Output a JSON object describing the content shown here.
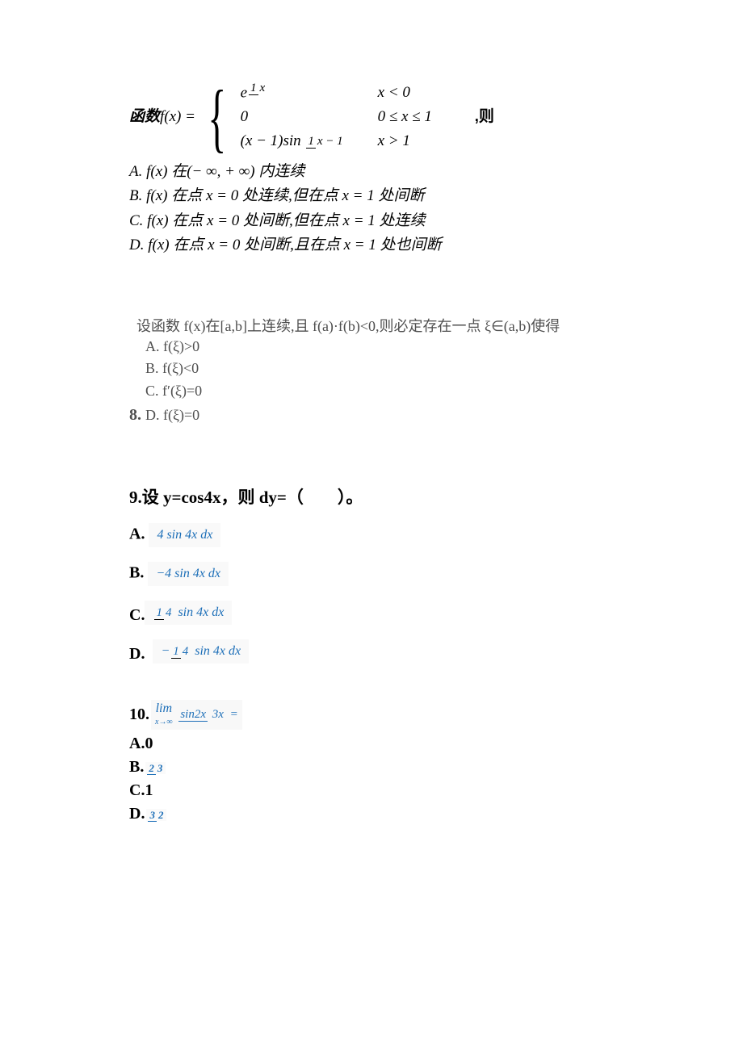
{
  "q7": {
    "label_prefix": "函数 ",
    "fx_equals": "f(x) = ",
    "piece1_left_base": "e",
    "piece1_left_exp_num": "1",
    "piece1_left_exp_den": "x",
    "piece1_right": "x < 0",
    "piece2_left": "0",
    "piece2_right": "0 ≤ x ≤ 1",
    "piece3_left_a": "(x − 1)sin ",
    "piece3_left_frac_num": "1",
    "piece3_left_frac_den": "x − 1",
    "piece3_right": "x > 1",
    "tail": " ,则",
    "A": "A. f(x) 在(− ∞, + ∞) 内连续",
    "B": "B. f(x) 在点 x = 0 处连续,但在点 x = 1 处间断",
    "C": "C. f(x) 在点 x = 0 处间断,但在点 x = 1 处连续",
    "D": "D. f(x) 在点 x = 0 处间断,且在点 x = 1 处也间断"
  },
  "q8": {
    "number": "8.",
    "stem": "  设函数 f(x)在[a,b]上连续,且 f(a)·f(b)<0,则必定存在一点 ξ∈(a,b)使得",
    "A": "A. f(ξ)>0",
    "B": "B. f(ξ)<0",
    "C": "C. f′(ξ)=0",
    "D": "D. f(ξ)=0"
  },
  "q9": {
    "number": "9.",
    "stem": "设 y=cos4x，则 dy=（　　）。",
    "A_label": "A.",
    "A_expr": "4 sin 4x dx",
    "B_label": "B.",
    "B_expr": "−4 sin 4x dx",
    "C_label": "C.",
    "C_frac_num": "1",
    "C_frac_den": "4",
    "C_rest": " sin 4x dx",
    "D_label": "D.",
    "D_minus": "−",
    "D_frac_num": "1",
    "D_frac_den": "4",
    "D_rest": " sin 4x dx"
  },
  "q10": {
    "number": "10.",
    "lim_under": "x→∞",
    "frac_num": "sin2x",
    "frac_den": "3x",
    "equals": " =",
    "A": "A.0",
    "B_label": "B.",
    "B_num": "2",
    "B_den": "3",
    "C": "C.1",
    "D_label": "D.",
    "D_num": "3",
    "D_den": "2"
  }
}
